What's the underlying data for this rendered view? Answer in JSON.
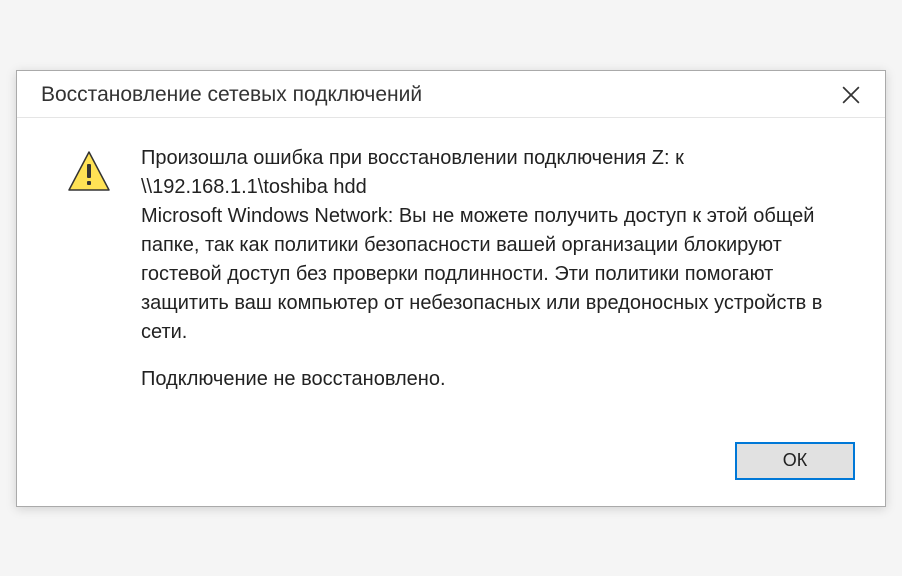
{
  "dialog": {
    "title": "Восстановление сетевых подключений",
    "message": "Произошла ошибка при восстановлении подключения Z: к \\\\192.168.1.1\\toshiba hdd\nMicrosoft Windows Network: Вы не можете получить доступ к этой общей папке, так как политики безопасности вашей организации блокируют гостевой доступ без проверки подлинности. Эти политики помогают защитить ваш компьютер от небезопасных или вредоносных устройств в сети.",
    "footnote": "Подключение не восстановлено.",
    "ok_label": "ОК"
  }
}
